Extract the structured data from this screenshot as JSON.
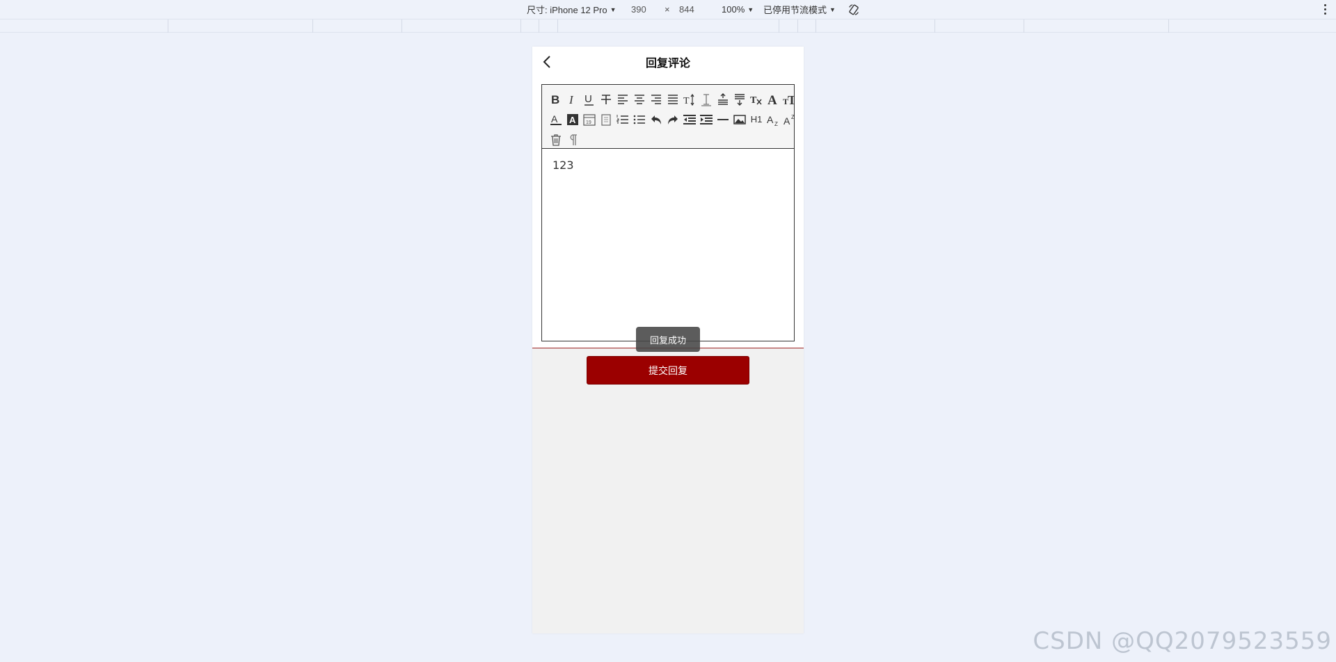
{
  "devtools": {
    "device_label": "尺寸: iPhone 12 Pro",
    "width": "390",
    "times": "×",
    "height": "844",
    "zoom": "100%",
    "throttle": "已停用节流模式"
  },
  "page": {
    "title": "回复评论",
    "editor_content": "123",
    "toast": "回复成功",
    "submit_label": "提交回复"
  },
  "toolbar_row1": [
    "bold-icon",
    "italic-icon",
    "underline-icon",
    "strikethrough-icon",
    "align-left-icon",
    "align-center-icon",
    "align-right-icon",
    "align-justify-icon",
    "font-size-icon",
    "line-height-icon",
    "paragraph-spacing-before-icon",
    "paragraph-spacing-after-icon",
    "clear-format-icon",
    "font-family-icon",
    "text-size-icon"
  ],
  "toolbar_row2": [
    "font-color-icon",
    "background-color-icon",
    "date-icon",
    "clipboard-icon",
    "ordered-list-icon",
    "unordered-list-icon",
    "undo-icon",
    "redo-icon",
    "outdent-icon",
    "indent-icon",
    "horizontal-rule-icon",
    "image-icon",
    "h1-icon",
    "subscript-icon",
    "superscript-icon"
  ],
  "toolbar_row3": [
    "delete-icon",
    "paragraph-mark-icon"
  ],
  "toolbar_labels": {
    "h1": "H1"
  },
  "watermark": "CSDN @QQ2079523559",
  "colors": {
    "accent": "#9b0000",
    "background": "#edf1fa",
    "toast": "#464646"
  }
}
